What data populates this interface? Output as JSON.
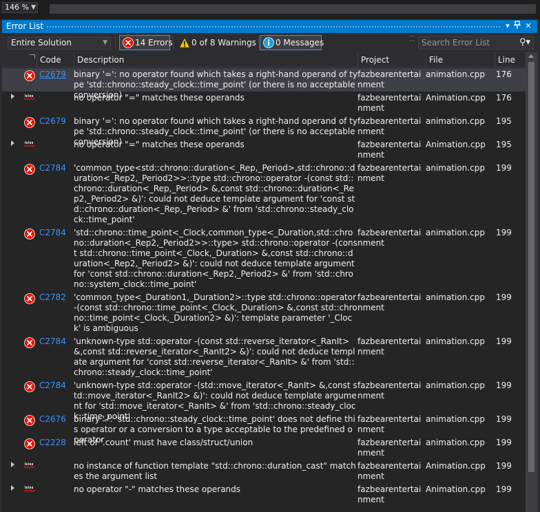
{
  "zoom": {
    "value": "146 %"
  },
  "panel": {
    "title": "Error List"
  },
  "toolbar": {
    "scope": "Entire Solution",
    "errors_label": "14 Errors",
    "warnings_label": "0 of 8 Warnings",
    "messages_label": "0 Messages",
    "search_placeholder": "Search Error List"
  },
  "columns": {
    "code": "Code",
    "description": "Description",
    "project": "Project",
    "file": "File",
    "line": "Line"
  },
  "rows": [
    {
      "type": "error",
      "code": "C2679",
      "description": "binary '=': no operator found which takes a right-hand operand of type 'std::chrono::steady_clock::time_point' (or there is no acceptable conversion)",
      "project": "fazbearentertainment",
      "file": "animation.cpp",
      "line": "176",
      "selected": true
    },
    {
      "type": "intellisense",
      "code": "",
      "description": "no operator \"=\" matches these operands",
      "project": "fazbearentertainment",
      "file": "Animation.cpp",
      "line": "176"
    },
    {
      "type": "error",
      "code": "C2679",
      "description": "binary '=': no operator found which takes a right-hand operand of type 'std::chrono::steady_clock::time_point' (or there is no acceptable conversion)",
      "project": "fazbearentertainment",
      "file": "animation.cpp",
      "line": "195"
    },
    {
      "type": "intellisense",
      "code": "",
      "description": "no operator \"=\" matches these operands",
      "project": "fazbearentertainment",
      "file": "Animation.cpp",
      "line": "195"
    },
    {
      "type": "error",
      "code": "C2784",
      "description": "'common_type<std::chrono::duration<_Rep,_Period>,std::chrono::duration<_Rep2,_Period2>>::type std::chrono::operator -(const std::chrono::duration<_Rep,_Period> &,const std::chrono::duration<_Rep2,_Period2> &)': could not deduce template argument for 'const std::chrono::duration<_Rep,_Period> &' from 'std::chrono::steady_clock::time_point'",
      "project": "fazbearentertainment",
      "file": "animation.cpp",
      "line": "199"
    },
    {
      "type": "error",
      "code": "C2784",
      "description": "'std::chrono::time_point<_Clock,common_type<_Duration,std::chrono::duration<_Rep2,_Period2>>::type> std::chrono::operator -(const std::chrono::time_point<_Clock,_Duration> &,const std::chrono::duration<_Rep2,_Period2> &)': could not deduce template argument for 'const std::chrono::duration<_Rep2,_Period2> &' from 'std::chrono::system_clock::time_point'",
      "project": "fazbearentertainment",
      "file": "animation.cpp",
      "line": "199"
    },
    {
      "type": "error",
      "code": "C2782",
      "description": "'common_type<_Duration1,_Duration2>::type std::chrono::operator -(const std::chrono::time_point<_Clock,_Duration> &,const std::chrono::time_point<_Clock,_Duration2> &)': template parameter '_Clock' is ambiguous",
      "project": "fazbearentertainment",
      "file": "animation.cpp",
      "line": "199"
    },
    {
      "type": "error",
      "code": "C2784",
      "description": "'unknown-type std::operator -(const std::reverse_iterator<_RanIt> &,const std::reverse_iterator<_RanIt2> &)': could not deduce template argument for 'const std::reverse_iterator<_RanIt> &' from 'std::chrono::steady_clock::time_point'",
      "project": "fazbearentertainment",
      "file": "animation.cpp",
      "line": "199"
    },
    {
      "type": "error",
      "code": "C2784",
      "description": "'unknown-type std::operator -(std::move_iterator<_RanIt> &,const std::move_iterator<_RanIt2> &)': could not deduce template argument for 'std::move_iterator<_RanIt> &' from 'std::chrono::steady_clock::time_point'",
      "project": "fazbearentertainment",
      "file": "animation.cpp",
      "line": "199"
    },
    {
      "type": "error",
      "code": "C2676",
      "description": "binary '-': 'std::chrono::steady_clock::time_point' does not define this operator or a conversion to a type acceptable to the predefined operator",
      "project": "fazbearentertainment",
      "file": "animation.cpp",
      "line": "199"
    },
    {
      "type": "error",
      "code": "C2228",
      "description": "left of '.count' must have class/struct/union",
      "project": "fazbearentertainment",
      "file": "animation.cpp",
      "line": "199"
    },
    {
      "type": "intellisense",
      "code": "",
      "description": "no instance of function template \"std::chrono::duration_cast\" matches the argument list",
      "project": "fazbearentertainment",
      "file": "Animation.cpp",
      "line": "199"
    },
    {
      "type": "intellisense",
      "code": "",
      "description": "no operator \"-\" matches these operands",
      "project": "fazbearentertainment",
      "file": "Animation.cpp",
      "line": "199"
    }
  ]
}
